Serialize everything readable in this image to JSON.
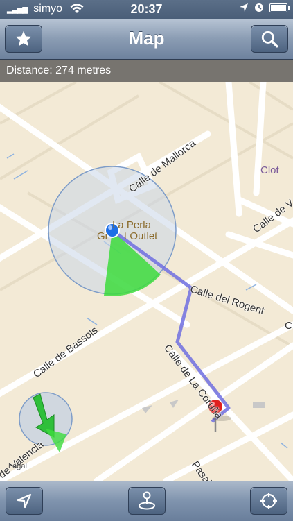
{
  "status_bar": {
    "carrier": "simyo",
    "time": "20:37",
    "icons": [
      "signal-icon",
      "wifi-icon",
      "location-arrow-icon",
      "clock-icon",
      "battery-icon"
    ]
  },
  "navbar": {
    "title": "Map",
    "left_button_icon": "star-icon",
    "right_button_icon": "search-icon"
  },
  "distance_label": "Distance: 274 metres",
  "map": {
    "streets": [
      "Calle de Mallorca",
      "Calle de V",
      "Calle del Rogent",
      "C",
      "Calle de Bassols",
      "Calle de La Coruña",
      "de Valencia",
      "Pasaje"
    ],
    "poi": "La Perla Gift Outlet",
    "poi_line1": "La Perla",
    "poi_line2": "Gi",
    "poi_line3": "t Outlet",
    "district": "Clot",
    "legal": "Legal"
  },
  "toolbar": {
    "left_icon": "location-arrow-icon",
    "center_icon": "joystick-icon",
    "right_icon": "crosshair-icon"
  },
  "colors": {
    "route": "#6f6fe0",
    "heading_cone": "#3ddc3d",
    "accuracy_circle": "#9fb4d6",
    "pin": "#e0201e",
    "user_dot": "#1e6fe6"
  }
}
